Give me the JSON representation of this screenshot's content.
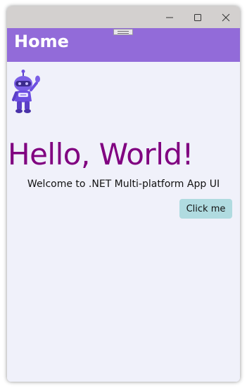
{
  "window": {
    "caption_buttons": {
      "minimize_icon": "minimize-icon",
      "maximize_icon": "maximize-icon",
      "close_icon": "close-icon"
    }
  },
  "navbar": {
    "title": "Home",
    "background_color": "#926bd9"
  },
  "main": {
    "image_icon": "dotnet-bot-icon",
    "heading": "Hello, World!",
    "heading_color": "#800080",
    "subtitle": "Welcome to .NET Multi-platform App UI",
    "button_label": "Click me",
    "button_color": "#b0dbe0"
  }
}
